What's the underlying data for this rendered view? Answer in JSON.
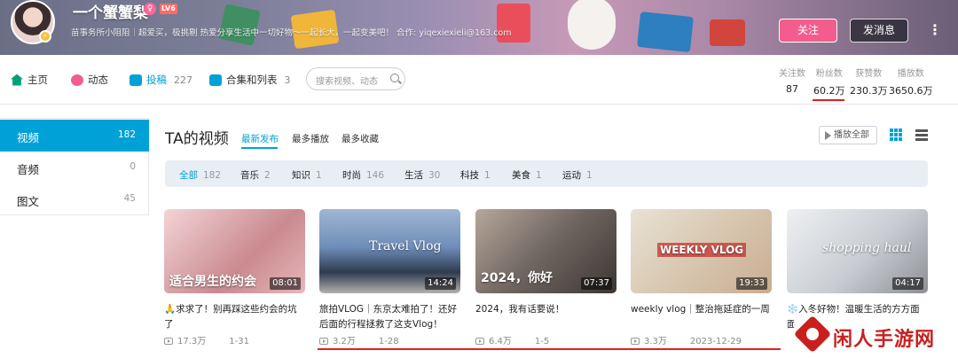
{
  "header": {
    "username": "一个蟹蟹梨",
    "gender_icon": "female-icon",
    "level": "LV6",
    "signature": "苗事务所小阻阻｜超爱买，极挑剔 热爱分享生活中一切好物～一起长大，一起变美吧！ 合作: yiqexiexieli@163.com",
    "follow_label": "关注",
    "message_label": "发消息",
    "more_icon": "more-vertical-icon"
  },
  "nav": {
    "tabs": [
      {
        "label": "主页",
        "count": "",
        "icon": "home-icon",
        "color": "#00a178"
      },
      {
        "label": "动态",
        "count": "",
        "icon": "dynamic-icon",
        "color": "#f25d8e"
      },
      {
        "label": "投稿",
        "count": "227",
        "icon": "upload-icon",
        "color": "#00a1d6"
      },
      {
        "label": "合集和列表",
        "count": "3",
        "icon": "collection-icon",
        "color": "#00a1d6"
      }
    ],
    "search_placeholder": "搜索视频、动态",
    "stats": [
      {
        "label": "关注数",
        "value": "87"
      },
      {
        "label": "粉丝数",
        "value": "60.2万"
      },
      {
        "label": "获赞数",
        "value": "230.3万"
      },
      {
        "label": "播放数",
        "value": "3650.6万"
      }
    ]
  },
  "sidebar": {
    "items": [
      {
        "label": "视频",
        "count": "182"
      },
      {
        "label": "音频",
        "count": "0"
      },
      {
        "label": "图文",
        "count": "45"
      }
    ]
  },
  "main": {
    "title": "TA的视频",
    "sorts": [
      "最新发布",
      "最多播放",
      "最多收藏"
    ],
    "play_all": "播放全部",
    "filters": [
      {
        "label": "全部",
        "count": "182"
      },
      {
        "label": "音乐",
        "count": "2"
      },
      {
        "label": "知识",
        "count": "1"
      },
      {
        "label": "时尚",
        "count": "146"
      },
      {
        "label": "生活",
        "count": "30"
      },
      {
        "label": "科技",
        "count": "1"
      },
      {
        "label": "美食",
        "count": "1"
      },
      {
        "label": "运动",
        "count": "1"
      }
    ]
  },
  "videos": [
    {
      "title": "🙏求求了！别再踩这些约会的坑了",
      "views": "17.3万",
      "date": "1-31",
      "duration": "08:01",
      "overlay": "适合男生的约会"
    },
    {
      "title": "旅拍VLOG｜东京太难拍了！还好后面的行程拯救了这支Vlog！",
      "views": "3.2万",
      "date": "1-28",
      "duration": "14:24",
      "overlay": "Travel Vlog"
    },
    {
      "title": "2024，我有话要说！",
      "views": "6.4万",
      "date": "1-5",
      "duration": "07:37",
      "overlay": "2024，你好"
    },
    {
      "title": "weekly vlog｜整治拖延症的一周",
      "views": "3.3万",
      "date": "2023-12-29",
      "duration": "19:33",
      "overlay": "WEEKLY VLOG"
    },
    {
      "title": "❄️入冬好物！温暖生活的方方面面",
      "views": "",
      "date": "",
      "duration": "04:17",
      "overlay": "shopping haul"
    }
  ],
  "watermark": {
    "text": "闲人手游网"
  }
}
